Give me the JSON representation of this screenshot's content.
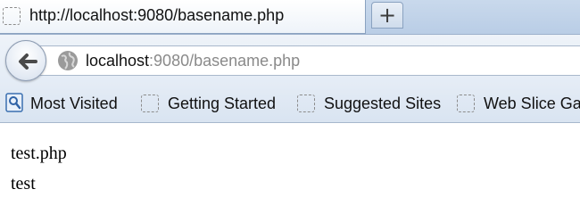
{
  "tab": {
    "title": "http://localhost:9080/basename.php",
    "favicon": "blank-page-icon"
  },
  "new_tab": {
    "label": "+"
  },
  "nav": {
    "url_host": "localhost",
    "url_rest": ":9080/basename.php"
  },
  "bookmarks": [
    {
      "label": "Most Visited",
      "icon": "most-visited-icon"
    },
    {
      "label": "Getting Started",
      "icon": "blank-page-icon"
    },
    {
      "label": "Suggested Sites",
      "icon": "blank-page-icon"
    },
    {
      "label": "Web Slice Ga",
      "icon": "blank-page-icon"
    }
  ],
  "page": {
    "lines": [
      "test.php",
      "test"
    ]
  }
}
